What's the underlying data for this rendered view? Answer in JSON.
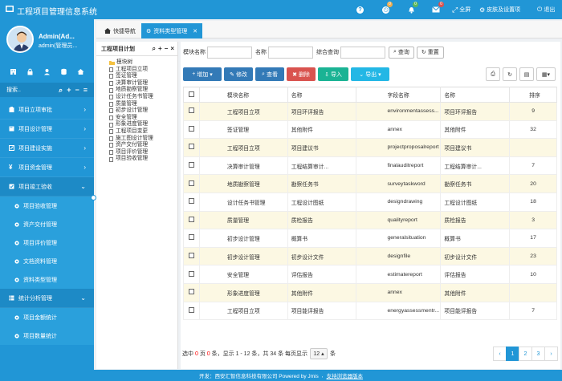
{
  "app": {
    "title": "工程项目管理信息系统"
  },
  "topbar": {
    "help_badge": "",
    "clock_badge": "0",
    "bell_badge": "0",
    "mail_badge": "0",
    "fullscreen": "全屏",
    "skin": "皮肤及设置项",
    "logout": "退出"
  },
  "user": {
    "name": "Admin(Ad...",
    "sub": "admin(管理员..."
  },
  "sidebar": {
    "search_label": "搜索..",
    "menu": [
      {
        "label": "项目立项审批",
        "icon": "clipboard-icon"
      },
      {
        "label": "项目设计管理",
        "icon": "book-icon"
      },
      {
        "label": "项目建设实施",
        "icon": "edit-icon"
      },
      {
        "label": "项目资金管理",
        "icon": "yen-icon"
      },
      {
        "label": "项目竣工验收",
        "icon": "check-square-icon"
      }
    ],
    "submenu": [
      {
        "label": "项目验收管理"
      },
      {
        "label": "资产交付管理"
      },
      {
        "label": "项目评价管理"
      },
      {
        "label": "文档资料管理"
      },
      {
        "label": "资料类型管理"
      }
    ],
    "menu2": {
      "label": "统计分析管理"
    },
    "submenu2": [
      {
        "label": "项目金额统计"
      },
      {
        "label": "项目数量统计"
      }
    ]
  },
  "tabs": {
    "home": "快捷导航",
    "active": "资料类型管理"
  },
  "tree": {
    "title": "工程项目计划",
    "root": "模块树",
    "nodes": [
      "工程项目立项",
      "签证管理",
      "决算审计管理",
      "地质勘察管理",
      "设计任务书管理",
      "质量管理",
      "初步设计管理",
      "安全管理",
      "形象进度管理",
      "工程项目变更",
      "施工图设计管理",
      "资产交付管理",
      "项目评价管理",
      "项目验收管理"
    ]
  },
  "filters": {
    "module_label": "模块名称",
    "name_label": "名称",
    "combined_label": "综合查询",
    "query_btn": "查询",
    "reset_btn": "重置"
  },
  "toolbar": {
    "add": "增加",
    "edit": "修改",
    "view": "查看",
    "delete": "删除",
    "import": "导入",
    "export": "导出"
  },
  "table": {
    "headers": [
      "模块名称",
      "名称",
      "字段名称",
      "名称",
      "排序"
    ],
    "rows": [
      [
        "工程项目立项",
        "项目环评报告",
        "environmentassess...",
        "项目环评报告",
        "9"
      ],
      [
        "签证管理",
        "其他附件",
        "annex",
        "其他附件",
        "32"
      ],
      [
        "工程项目立项",
        "项目建议书",
        "projectproposalreport",
        "项目建议书",
        ""
      ],
      [
        "决算审计管理",
        "工程结算审计...",
        "finalauditreport",
        "工程结算审计...",
        "7"
      ],
      [
        "地质勘察管理",
        "勘察任务书",
        "surveytaskword",
        "勘察任务书",
        "20"
      ],
      [
        "设计任务书管理",
        "工程设计图纸",
        "designdrawing",
        "工程设计图纸",
        "18"
      ],
      [
        "质量管理",
        "质检报告",
        "qualityreport",
        "质检报告",
        "3"
      ],
      [
        "初步设计管理",
        "概算书",
        "generalsituation",
        "概算书",
        "17"
      ],
      [
        "初步设计管理",
        "初步设计文件",
        "designfile",
        "初步设计文件",
        "23"
      ],
      [
        "安全管理",
        "评估报告",
        "estimatereport",
        "评估报告",
        "10"
      ],
      [
        "形象进度管理",
        "其他附件",
        "annex",
        "其他附件",
        ""
      ],
      [
        "工程项目立项",
        "项目能评报告",
        "energyassessmentr...",
        "项目能评报告",
        "7"
      ]
    ]
  },
  "pager": {
    "text_a": "选中",
    "selected": "0",
    "text_b": "页",
    "page_sel": "0",
    "text_c": "条，显示 1 - 12 条，共 34 条 每页显示",
    "per_page": "12",
    "text_d": "条",
    "pages": [
      "‹",
      "1",
      "2",
      "3",
      "›"
    ]
  },
  "footer": {
    "dev": "开发：西安汇智信息科技有限公司 Powered by Jmis",
    "browser": "支持浏览器版本"
  }
}
